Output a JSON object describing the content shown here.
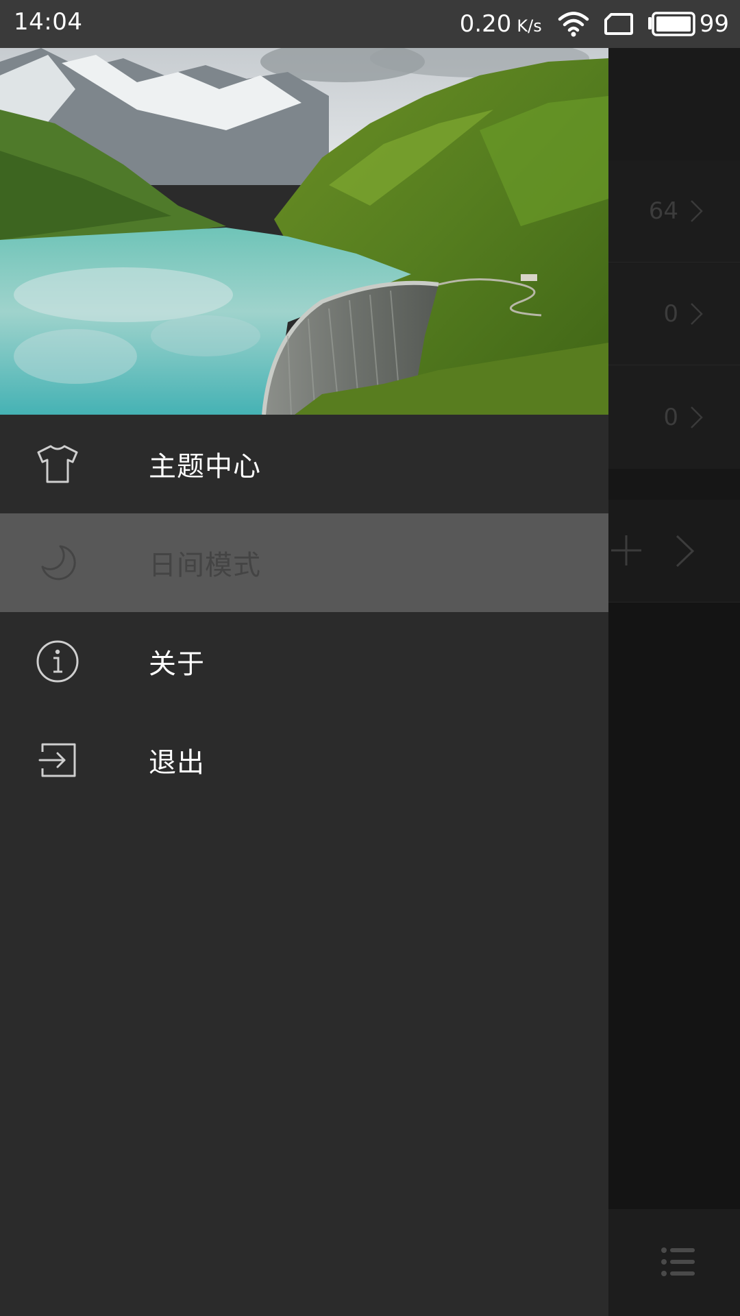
{
  "status_bar": {
    "time": "14:04",
    "net_speed": "0.20",
    "net_unit": "K/s",
    "battery": "99",
    "icons": [
      "wifi-icon",
      "sim-card-icon",
      "battery-icon"
    ]
  },
  "background_app": {
    "rows": [
      {
        "value": "64"
      },
      {
        "value": "0"
      },
      {
        "value": "0"
      }
    ],
    "icons": [
      "plus-icon",
      "chevron-right-icon",
      "list-menu-icon"
    ]
  },
  "drawer": {
    "header_image": "mountain-lake-dam-landscape",
    "menu": [
      {
        "icon": "tshirt-icon",
        "label": "主题中心"
      },
      {
        "icon": "moon-icon",
        "label": "日间模式",
        "active": true
      },
      {
        "icon": "info-icon",
        "label": "关于"
      },
      {
        "icon": "exit-icon",
        "label": "退出"
      }
    ]
  },
  "colors": {
    "drawer_bg": "#2b2b2b",
    "active_item_bg": "#585858",
    "status_bar_bg": "#3a3a3a",
    "text_primary": "#ffffff"
  }
}
